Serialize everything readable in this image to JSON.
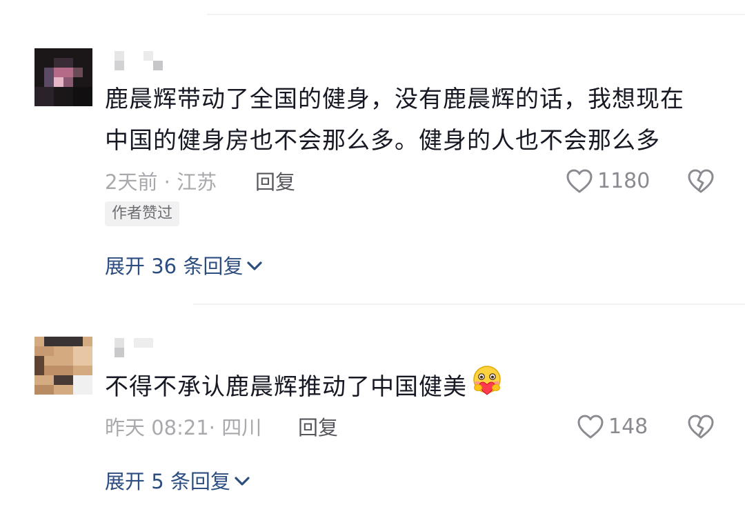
{
  "comments": [
    {
      "text_lines": [
        "鹿晨辉带动了全国的健身，没有鹿晨辉的话，我想现在",
        "中国的健身房也不会那么多。健身的人也不会那么多"
      ],
      "meta": "2天前 · 江苏",
      "reply_label": "回复",
      "likes": "1180",
      "badge": "作者赞过",
      "expand_label": "展开 36 条回复"
    },
    {
      "text_lines": [
        "不得不承认鹿晨辉推动了中国健美"
      ],
      "emoji": "hug-heart-emoji",
      "meta": "昨天 08:21· 四川",
      "reply_label": "回复",
      "likes": "148",
      "expand_label": "展开 5 条回复"
    }
  ],
  "icons": {
    "like": "heart-outline-icon",
    "dislike": "broken-heart-icon",
    "expand": "chevron-down-icon"
  },
  "colors": {
    "link_blue": "#2c4d80",
    "meta_gray": "#a8a9ad",
    "text": "#161823"
  }
}
